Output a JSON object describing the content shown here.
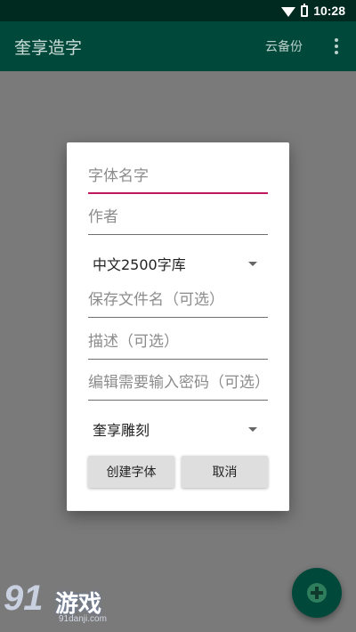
{
  "status_bar": {
    "time": "10:28"
  },
  "app_bar": {
    "title": "奎享造字",
    "cloud_backup": "云备份"
  },
  "dialog": {
    "font_name_placeholder": "字体名字",
    "author_placeholder": "作者",
    "charset_selected": "中文2500字库",
    "filename_placeholder": "保存文件名（可选）",
    "description_placeholder": "描述（可选）",
    "password_placeholder": "编辑需要输入密码（可选）",
    "style_selected": "奎享雕刻",
    "create_button": "创建字体",
    "cancel_button": "取消"
  },
  "watermark": {
    "brand_number": "91",
    "brand_text": "游戏",
    "url": "91danji.com"
  },
  "colors": {
    "primary": "#00493a",
    "status_bar": "#00291f",
    "accent": "#c0185c",
    "scrim": "#7a7a7a"
  }
}
